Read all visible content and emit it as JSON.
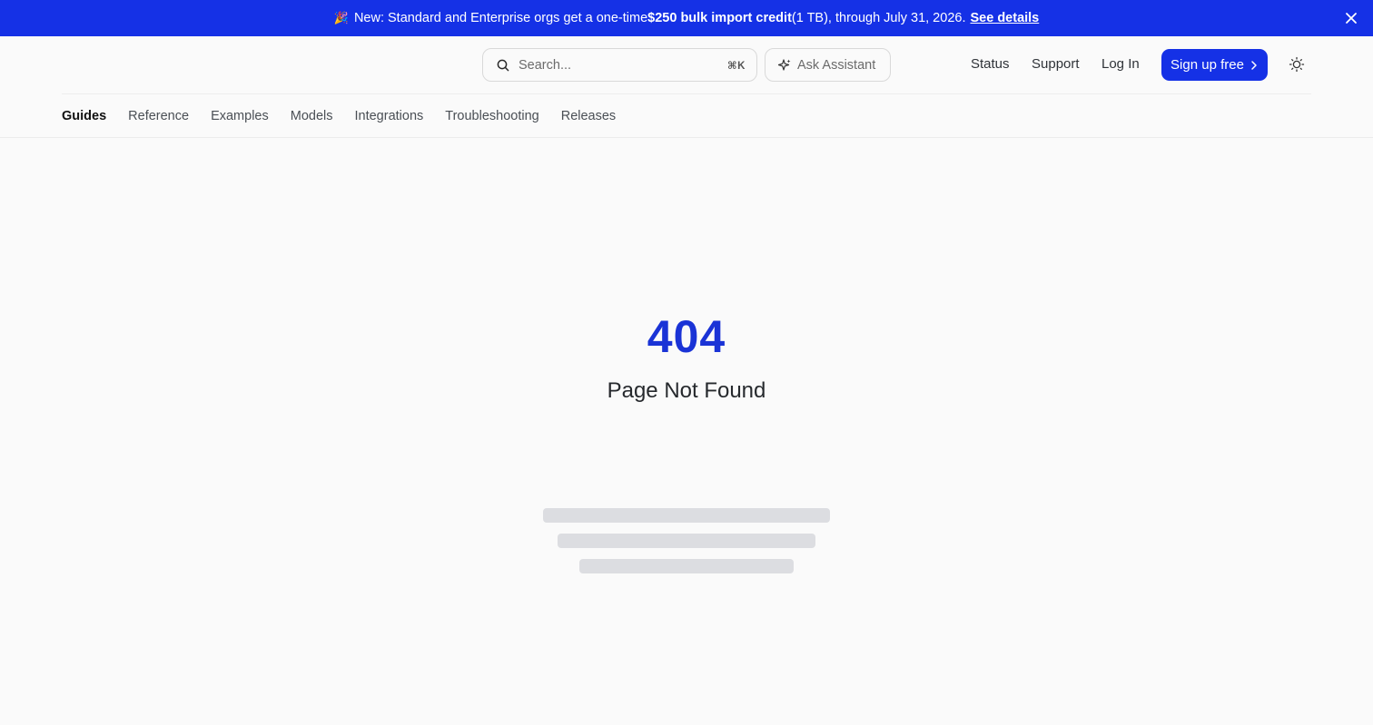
{
  "banner": {
    "emoji": "🎉",
    "prefix": "New: Standard and Enterprise orgs get a one-time ",
    "bold": "$250 bulk import credit",
    "suffix": " (1 TB), through July 31, 2026.",
    "link": "See details"
  },
  "search": {
    "placeholder": "Search...",
    "shortcut": "⌘K"
  },
  "assistant": {
    "label": "Ask Assistant"
  },
  "nav": {
    "status": "Status",
    "support": "Support",
    "login": "Log In",
    "signup": "Sign up free"
  },
  "tabs": [
    {
      "label": "Guides",
      "active": true
    },
    {
      "label": "Reference"
    },
    {
      "label": "Examples"
    },
    {
      "label": "Models"
    },
    {
      "label": "Integrations"
    },
    {
      "label": "Troubleshooting"
    },
    {
      "label": "Releases"
    }
  ],
  "error": {
    "code": "404",
    "message": "Page Not Found"
  },
  "colors": {
    "brand": "#1531e6",
    "code": "#1a33d6",
    "skeleton": "#dcdde1"
  }
}
